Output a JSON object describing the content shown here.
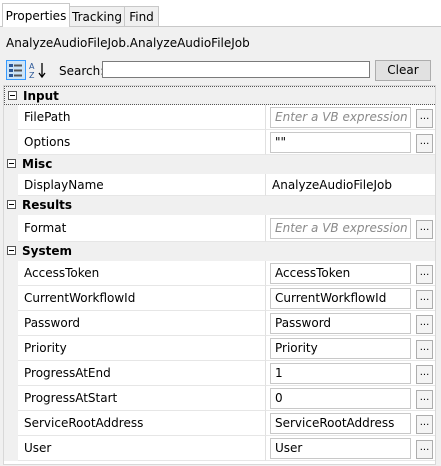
{
  "tabs": [
    {
      "label": "Properties",
      "active": true
    },
    {
      "label": "Tracking",
      "active": false
    },
    {
      "label": "Find",
      "active": false
    }
  ],
  "panel_title": "AnalyzeAudioFileJob.AnalyzeAudioFileJob",
  "toolbar": {
    "categorized_icon": "categorized-view-icon",
    "alphabetical_icon": "alphabetical-sort-icon",
    "search_label": "Search:",
    "search_value": "",
    "clear_label": "Clear"
  },
  "categories": {
    "input": {
      "label": "Input",
      "props": [
        {
          "name": "FilePath",
          "value": "Enter a VB expression",
          "placeholder": true
        },
        {
          "name": "Options",
          "value": "\"\"",
          "placeholder": false
        }
      ]
    },
    "misc": {
      "label": "Misc",
      "props": [
        {
          "name": "DisplayName",
          "value": "AnalyzeAudioFileJob"
        }
      ]
    },
    "results": {
      "label": "Results",
      "props": [
        {
          "name": "Format",
          "value": "Enter a VB expression",
          "placeholder": true
        }
      ]
    },
    "system": {
      "label": "System",
      "props": [
        {
          "name": "AccessToken",
          "value": "AccessToken"
        },
        {
          "name": "CurrentWorkflowId",
          "value": "CurrentWorkflowId"
        },
        {
          "name": "Password",
          "value": "Password"
        },
        {
          "name": "Priority",
          "value": "Priority"
        },
        {
          "name": "ProgressAtEnd",
          "value": "1"
        },
        {
          "name": "ProgressAtStart",
          "value": "0"
        },
        {
          "name": "ServiceRootAddress",
          "value": "ServiceRootAddress"
        },
        {
          "name": "User",
          "value": "User"
        }
      ]
    }
  },
  "ellipsis_label": "..."
}
